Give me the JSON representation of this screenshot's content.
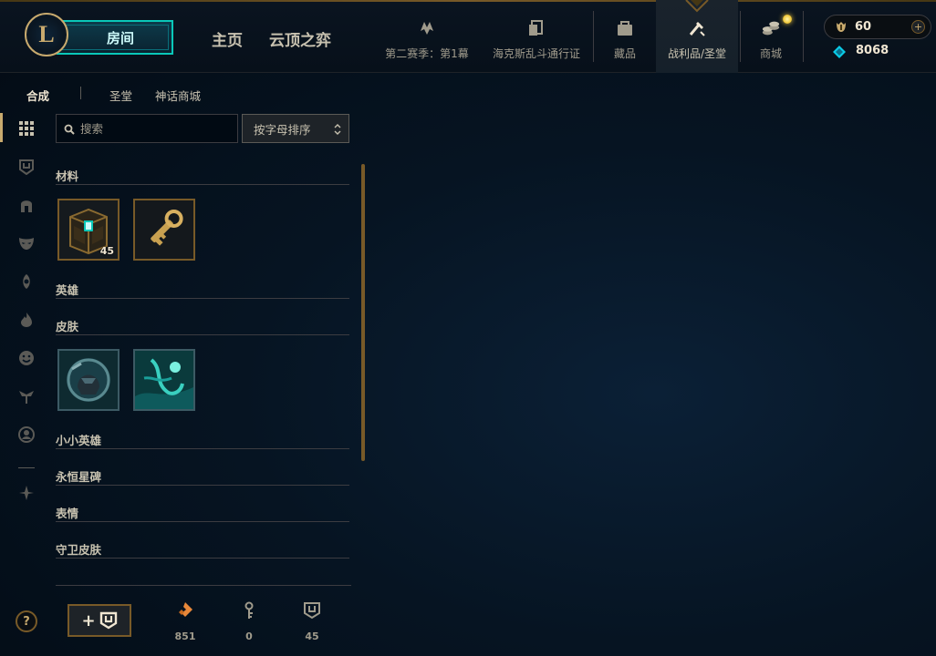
{
  "header": {
    "logo_letter": "L",
    "play_label": "房间",
    "nav_home": "主页",
    "nav_tft": "云顶之弈",
    "icon_items": [
      {
        "label": "第二赛季：第1幕",
        "icon": "season-icon"
      },
      {
        "label": "海克斯乱斗通行证",
        "icon": "pass-icon"
      },
      {
        "label": "藏品",
        "icon": "collection-icon"
      },
      {
        "label": "战利品/圣堂",
        "icon": "loot-icon"
      },
      {
        "label": "商城",
        "icon": "store-icon"
      }
    ],
    "rp": "60",
    "blue_essence": "8068",
    "plus": "+"
  },
  "subtabs": {
    "crafting": "合成",
    "sanctum": "圣堂",
    "mythic_shop": "神话商城"
  },
  "rail": {
    "items": [
      "grid-icon",
      "chest-icon",
      "helmet-icon",
      "mask-icon",
      "ward-icon",
      "flame-icon",
      "emote-icon",
      "eternals-icon",
      "profile-icon",
      "tft-icon"
    ],
    "help": "?"
  },
  "search": {
    "placeholder": "搜索",
    "value": ""
  },
  "sort": {
    "label": "按字母排序"
  },
  "sections": {
    "materials": "材料",
    "champions": "英雄",
    "skins": "皮肤",
    "little_legends": "小小英雄",
    "eternals": "永恒星碑",
    "emotes": "表情",
    "ward_skins": "守卫皮肤"
  },
  "materials": [
    {
      "name": "hextech-chest",
      "count": "45"
    },
    {
      "name": "hextech-key",
      "count": ""
    }
  ],
  "skins": [
    {
      "name": "skin-shard-1"
    },
    {
      "name": "skin-shard-2"
    }
  ],
  "bottom": {
    "craft_plus": "+",
    "orange_essence": "851",
    "key_fragments": "0",
    "chests": "45"
  },
  "colors": {
    "gold": "#c8aa6e",
    "gold_dark": "#785a28",
    "cyan": "#0ac8b9",
    "text": "#a09b8c",
    "text_bright": "#f0e6d2"
  }
}
